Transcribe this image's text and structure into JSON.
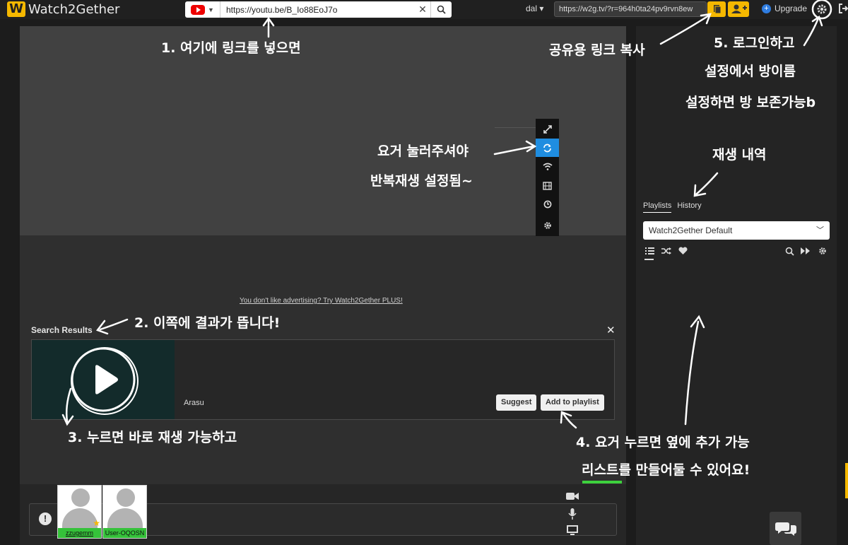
{
  "app": {
    "logo_letter": "W",
    "name": "Watch2Gether"
  },
  "search": {
    "source": "youtube-icon",
    "url_value": "https://youtu.be/B_Io88EoJ7o"
  },
  "header": {
    "user": "dal",
    "share_url": "https://w2g.tv/?r=964h0ta24pv9rvn8ew",
    "upgrade_label": "Upgrade"
  },
  "player": {
    "controls": [
      "expand-icon",
      "repeat-icon",
      "wifi-icon",
      "film-icon",
      "clock-icon",
      "gear-icon"
    ]
  },
  "ad_link": "You don't like advertising? Try Watch2Gether PLUS!",
  "results": {
    "title": "Search Results",
    "items": [
      {
        "channel": "Arasu",
        "suggest_label": "Suggest",
        "add_label": "Add to playlist"
      }
    ]
  },
  "users": [
    {
      "name": "zzugemm",
      "host": true
    },
    {
      "name": "User-OQOSN",
      "host": false
    }
  ],
  "sidebar": {
    "tabs": [
      "Playlists",
      "History"
    ],
    "active_tab": "Playlists",
    "playlist_selected": "Watch2Gether Default"
  },
  "annotations": {
    "a1": "1. 여기에 링크를 넣으면",
    "a_share": "공유용 링크 복사",
    "a5_line1": "5. 로그인하고",
    "a5_line2": "설정에서 방이름",
    "a5_line3": "설정하면 방 보존가능b",
    "a_loop_line1": "요거 눌러주셔야",
    "a_loop_line2": "반복재생 설정됨~",
    "a_history": "재생 내역",
    "a2": "2. 이쪽에 결과가 뜹니다!",
    "a3": "3. 누르면 바로 재생 가능하고",
    "a4_line1": "4. 요거 누르면 옆에 추가 가능",
    "a4_line2": "리스트를 만들어둘 수 있어요!"
  },
  "colors": {
    "accent": "#f5b800",
    "active_ctrl": "#1f8de0",
    "user_badge": "#35c23a",
    "highlight": "#3dd13d"
  }
}
